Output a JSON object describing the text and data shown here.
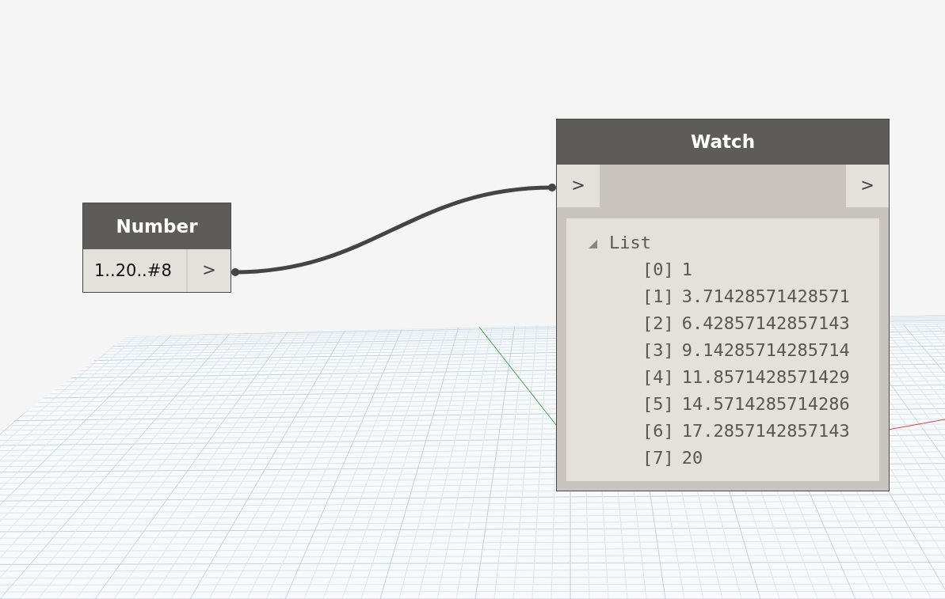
{
  "nodes": [
    {
      "kind": "number",
      "title": "Number",
      "value": "1..20..#8",
      "output_port": ">"
    },
    {
      "kind": "watch",
      "title": "Watch",
      "input_port": ">",
      "output_port": ">",
      "tree": {
        "label": "List",
        "expanded": true,
        "children": [
          {
            "index": "[0]",
            "value": "1"
          },
          {
            "index": "[1]",
            "value": "3.71428571428571"
          },
          {
            "index": "[2]",
            "value": "6.42857142857143"
          },
          {
            "index": "[3]",
            "value": "9.14285714285714"
          },
          {
            "index": "[4]",
            "value": "11.8571428571429"
          },
          {
            "index": "[5]",
            "value": "14.5714285714286"
          },
          {
            "index": "[6]",
            "value": "17.2857142857143"
          },
          {
            "index": "[7]",
            "value": "20"
          }
        ]
      }
    }
  ]
}
